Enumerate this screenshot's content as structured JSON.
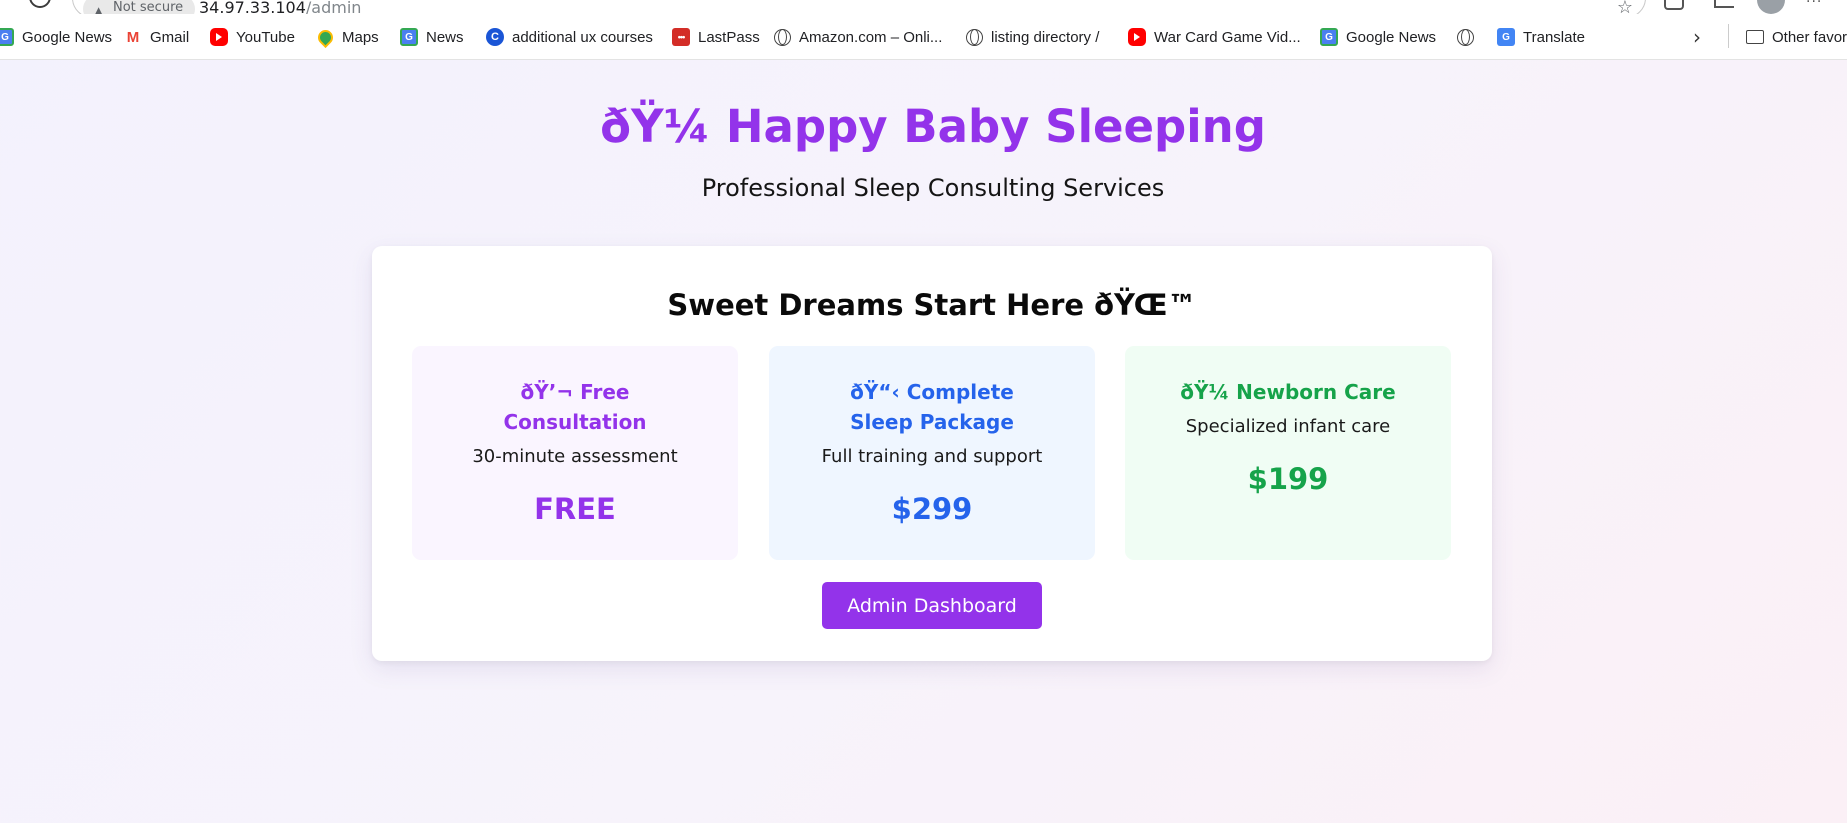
{
  "browser": {
    "security_label": "Not secure",
    "url_host": "34.97.33.104",
    "url_path": "/admin"
  },
  "bookmarks": [
    {
      "label": "Google News",
      "icon": "google-news-icon"
    },
    {
      "label": "Gmail",
      "icon": "gmail-icon"
    },
    {
      "label": "YouTube",
      "icon": "youtube-icon"
    },
    {
      "label": "Maps",
      "icon": "maps-icon"
    },
    {
      "label": "News",
      "icon": "google-news-icon"
    },
    {
      "label": "additional ux courses",
      "icon": "c-icon"
    },
    {
      "label": "LastPass",
      "icon": "lastpass-icon"
    },
    {
      "label": "Amazon.com – Onli...",
      "icon": "globe-icon"
    },
    {
      "label": "listing directory /",
      "icon": "globe-icon"
    },
    {
      "label": "War Card Game Vid...",
      "icon": "youtube-icon"
    },
    {
      "label": "Google News",
      "icon": "google-news-icon"
    },
    {
      "label": "",
      "icon": "globe-icon"
    },
    {
      "label": "Translate",
      "icon": "translate-icon"
    },
    {
      "label": "Other favorites",
      "icon": "folder-icon"
    }
  ],
  "page": {
    "title": "ðŸ¼ Happy Baby Sleeping",
    "subtitle": "Professional Sleep Consulting Services",
    "card_heading": "Sweet Dreams Start Here ðŸŒ™",
    "services": [
      {
        "name": "ðŸ’¬ Free Consultation",
        "description": "30-minute assessment",
        "price": "FREE",
        "color": "#9333ea"
      },
      {
        "name": "ðŸ“‹ Complete Sleep Package",
        "description": "Full training and support",
        "price": "$299",
        "color": "#2563eb"
      },
      {
        "name": "ðŸ¼ Newborn Care",
        "description": "Specialized infant care",
        "price": "$199",
        "color": "#16a34a"
      }
    ],
    "admin_button_label": "Admin Dashboard"
  },
  "colors": {
    "accent_purple": "#9333ea",
    "accent_blue": "#2563eb",
    "accent_green": "#16a34a"
  }
}
